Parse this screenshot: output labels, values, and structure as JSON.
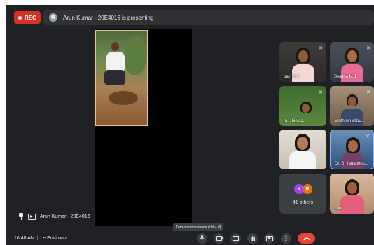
{
  "top_bar": {
    "rec_label": "REC",
    "presenting_text": "Arun Kumar - 20E4016 is presenting"
  },
  "presentation": {
    "presenter_label": "Arun Kumar - 20E4016"
  },
  "participants": [
    {
      "name": "pavi thra",
      "mic": "muted"
    },
    {
      "name": "Swetha M.J",
      "mic": "muted"
    },
    {
      "name": "m... biolog...",
      "mic": "muted"
    },
    {
      "name": "santhosh alibu...",
      "mic": "muted"
    },
    {
      "name": "",
      "mic": "muted"
    },
    {
      "name": "Dr. S. Jagadees...",
      "mic": "muted"
    },
    {
      "name": "You",
      "mic": "muted"
    }
  ],
  "others": {
    "avatars": [
      "K",
      "R"
    ],
    "label": "41 others"
  },
  "bottom_bar": {
    "time": "10:48 AM",
    "separator": "|",
    "meeting_name": "Le Environia",
    "mic_tooltip": "Turn on microphone (ctrl + d)"
  },
  "colors": {
    "background": "#202124",
    "rec": "#d93025",
    "end_call": "#ea4335",
    "active_speaker_border": "#8ab4f8"
  }
}
